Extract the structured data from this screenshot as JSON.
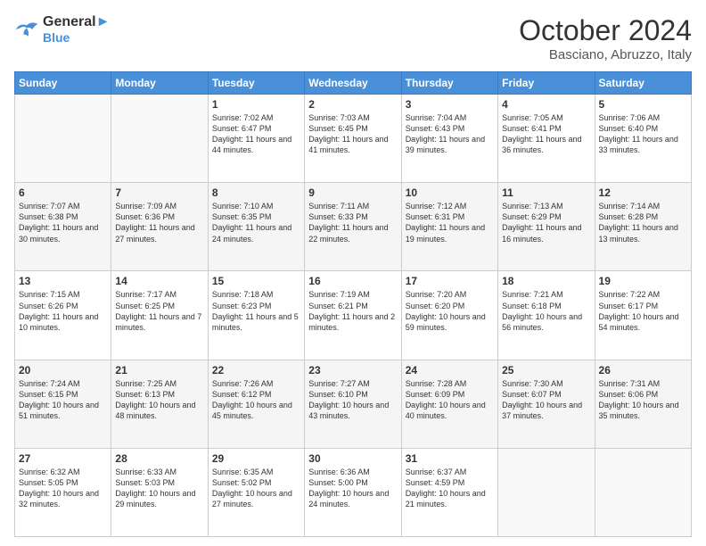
{
  "header": {
    "logo_line1": "General",
    "logo_line2": "Blue",
    "month": "October 2024",
    "location": "Basciano, Abruzzo, Italy"
  },
  "days_of_week": [
    "Sunday",
    "Monday",
    "Tuesday",
    "Wednesday",
    "Thursday",
    "Friday",
    "Saturday"
  ],
  "weeks": [
    [
      {
        "day": "",
        "info": ""
      },
      {
        "day": "",
        "info": ""
      },
      {
        "day": "1",
        "info": "Sunrise: 7:02 AM\nSunset: 6:47 PM\nDaylight: 11 hours and 44 minutes."
      },
      {
        "day": "2",
        "info": "Sunrise: 7:03 AM\nSunset: 6:45 PM\nDaylight: 11 hours and 41 minutes."
      },
      {
        "day": "3",
        "info": "Sunrise: 7:04 AM\nSunset: 6:43 PM\nDaylight: 11 hours and 39 minutes."
      },
      {
        "day": "4",
        "info": "Sunrise: 7:05 AM\nSunset: 6:41 PM\nDaylight: 11 hours and 36 minutes."
      },
      {
        "day": "5",
        "info": "Sunrise: 7:06 AM\nSunset: 6:40 PM\nDaylight: 11 hours and 33 minutes."
      }
    ],
    [
      {
        "day": "6",
        "info": "Sunrise: 7:07 AM\nSunset: 6:38 PM\nDaylight: 11 hours and 30 minutes."
      },
      {
        "day": "7",
        "info": "Sunrise: 7:09 AM\nSunset: 6:36 PM\nDaylight: 11 hours and 27 minutes."
      },
      {
        "day": "8",
        "info": "Sunrise: 7:10 AM\nSunset: 6:35 PM\nDaylight: 11 hours and 24 minutes."
      },
      {
        "day": "9",
        "info": "Sunrise: 7:11 AM\nSunset: 6:33 PM\nDaylight: 11 hours and 22 minutes."
      },
      {
        "day": "10",
        "info": "Sunrise: 7:12 AM\nSunset: 6:31 PM\nDaylight: 11 hours and 19 minutes."
      },
      {
        "day": "11",
        "info": "Sunrise: 7:13 AM\nSunset: 6:29 PM\nDaylight: 11 hours and 16 minutes."
      },
      {
        "day": "12",
        "info": "Sunrise: 7:14 AM\nSunset: 6:28 PM\nDaylight: 11 hours and 13 minutes."
      }
    ],
    [
      {
        "day": "13",
        "info": "Sunrise: 7:15 AM\nSunset: 6:26 PM\nDaylight: 11 hours and 10 minutes."
      },
      {
        "day": "14",
        "info": "Sunrise: 7:17 AM\nSunset: 6:25 PM\nDaylight: 11 hours and 7 minutes."
      },
      {
        "day": "15",
        "info": "Sunrise: 7:18 AM\nSunset: 6:23 PM\nDaylight: 11 hours and 5 minutes."
      },
      {
        "day": "16",
        "info": "Sunrise: 7:19 AM\nSunset: 6:21 PM\nDaylight: 11 hours and 2 minutes."
      },
      {
        "day": "17",
        "info": "Sunrise: 7:20 AM\nSunset: 6:20 PM\nDaylight: 10 hours and 59 minutes."
      },
      {
        "day": "18",
        "info": "Sunrise: 7:21 AM\nSunset: 6:18 PM\nDaylight: 10 hours and 56 minutes."
      },
      {
        "day": "19",
        "info": "Sunrise: 7:22 AM\nSunset: 6:17 PM\nDaylight: 10 hours and 54 minutes."
      }
    ],
    [
      {
        "day": "20",
        "info": "Sunrise: 7:24 AM\nSunset: 6:15 PM\nDaylight: 10 hours and 51 minutes."
      },
      {
        "day": "21",
        "info": "Sunrise: 7:25 AM\nSunset: 6:13 PM\nDaylight: 10 hours and 48 minutes."
      },
      {
        "day": "22",
        "info": "Sunrise: 7:26 AM\nSunset: 6:12 PM\nDaylight: 10 hours and 45 minutes."
      },
      {
        "day": "23",
        "info": "Sunrise: 7:27 AM\nSunset: 6:10 PM\nDaylight: 10 hours and 43 minutes."
      },
      {
        "day": "24",
        "info": "Sunrise: 7:28 AM\nSunset: 6:09 PM\nDaylight: 10 hours and 40 minutes."
      },
      {
        "day": "25",
        "info": "Sunrise: 7:30 AM\nSunset: 6:07 PM\nDaylight: 10 hours and 37 minutes."
      },
      {
        "day": "26",
        "info": "Sunrise: 7:31 AM\nSunset: 6:06 PM\nDaylight: 10 hours and 35 minutes."
      }
    ],
    [
      {
        "day": "27",
        "info": "Sunrise: 6:32 AM\nSunset: 5:05 PM\nDaylight: 10 hours and 32 minutes."
      },
      {
        "day": "28",
        "info": "Sunrise: 6:33 AM\nSunset: 5:03 PM\nDaylight: 10 hours and 29 minutes."
      },
      {
        "day": "29",
        "info": "Sunrise: 6:35 AM\nSunset: 5:02 PM\nDaylight: 10 hours and 27 minutes."
      },
      {
        "day": "30",
        "info": "Sunrise: 6:36 AM\nSunset: 5:00 PM\nDaylight: 10 hours and 24 minutes."
      },
      {
        "day": "31",
        "info": "Sunrise: 6:37 AM\nSunset: 4:59 PM\nDaylight: 10 hours and 21 minutes."
      },
      {
        "day": "",
        "info": ""
      },
      {
        "day": "",
        "info": ""
      }
    ]
  ]
}
